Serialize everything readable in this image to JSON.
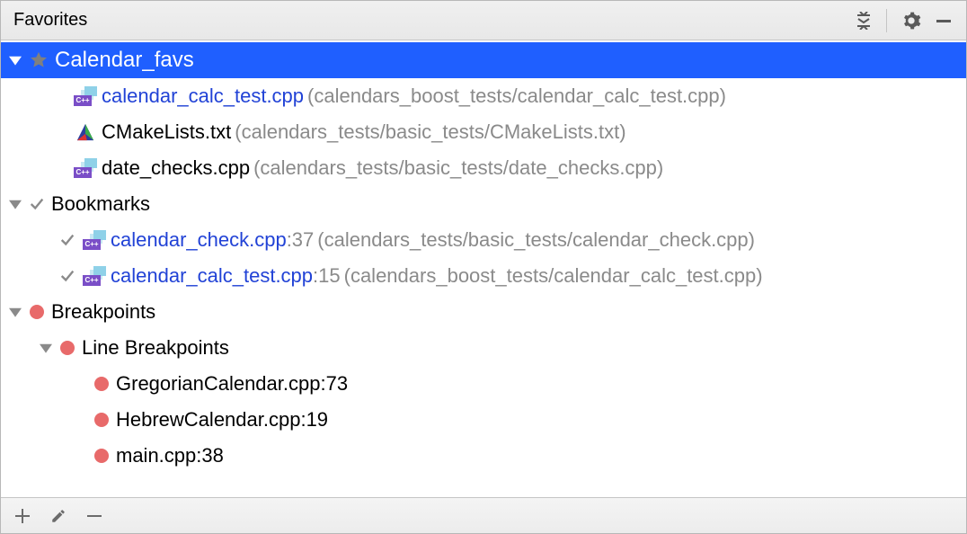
{
  "header": {
    "title": "Favorites"
  },
  "favorites": {
    "label": "Calendar_favs",
    "items": [
      {
        "name": "calendar_calc_test.cpp",
        "path": "(calendars_boost_tests/calendar_calc_test.cpp)",
        "icon": "cpp"
      },
      {
        "name": "CMakeLists.txt",
        "path": "(calendars_tests/basic_tests/CMakeLists.txt)",
        "icon": "cmake",
        "plain": true
      },
      {
        "name": "date_checks.cpp",
        "path": "(calendars_tests/basic_tests/date_checks.cpp)",
        "icon": "cpp",
        "plain": true
      }
    ]
  },
  "bookmarks": {
    "label": "Bookmarks",
    "items": [
      {
        "name": "calendar_check.cpp",
        "line": ":37",
        "path": "(calendars_tests/basic_tests/calendar_check.cpp)"
      },
      {
        "name": "calendar_calc_test.cpp",
        "line": ":15",
        "path": "(calendars_boost_tests/calendar_calc_test.cpp)"
      }
    ]
  },
  "breakpoints": {
    "label": "Breakpoints",
    "group_label": "Line Breakpoints",
    "items": [
      {
        "label": "GregorianCalendar.cpp:73"
      },
      {
        "label": "HebrewCalendar.cpp:19"
      },
      {
        "label": "main.cpp:38"
      }
    ]
  }
}
